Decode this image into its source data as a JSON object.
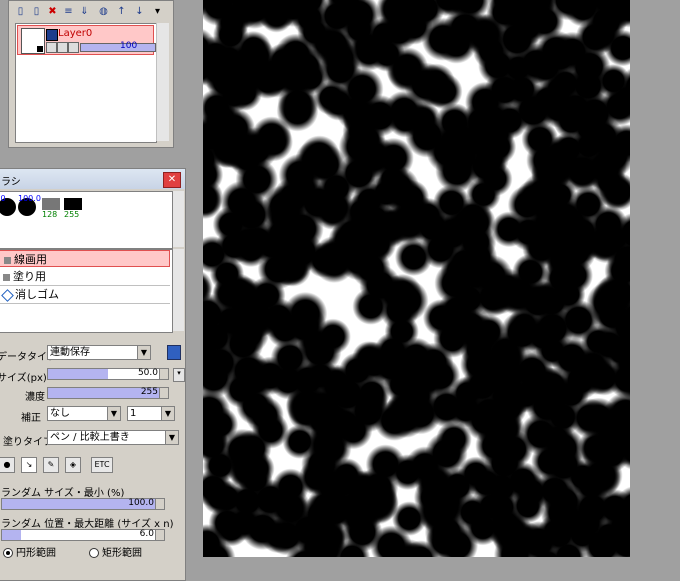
{
  "layer_panel": {
    "toolbar_icons": [
      "new-layer-icon",
      "new-layer-copy-icon",
      "delete-layer-icon",
      "merge-icon",
      "transfer-icon",
      "mask-icon",
      "move-up-icon",
      "move-down-icon",
      "menu-icon"
    ],
    "layer": {
      "name": "Layer0",
      "opacity": "100"
    }
  },
  "brush_panel": {
    "title": "ラシ",
    "presets": [
      {
        "value": ".0"
      },
      {
        "value": "100.0"
      },
      {
        "value": "128"
      },
      {
        "value": "255"
      }
    ],
    "tools": [
      {
        "label": "線画用",
        "selected": true
      },
      {
        "label": "塗り用",
        "selected": false
      },
      {
        "label": "消しゴム",
        "selected": false
      }
    ],
    "data_type_label": "データタイプ",
    "data_type_value": "連動保存",
    "size_label": "サイズ(px)",
    "size_value": "50.0",
    "density_label": "濃度",
    "density_value": "255",
    "correction_label": "補正",
    "correction_value": "なし",
    "correction_level": "1",
    "paint_type_label": "塗りタイプ",
    "paint_type_value": "ペン / 比較上書き",
    "random_size_label": "ランダム サイズ・最小 (%)",
    "random_size_value": "100.0",
    "random_pos_label": "ランダム 位置・最大距離 (サイズ x n)",
    "random_pos_value": "6.0",
    "range_circle": "円形範囲",
    "range_rect": "矩形範囲"
  },
  "colors": {
    "selected_row": "#ffc8c8",
    "slider_fill": "#b4b4f0",
    "canvas_bg": "#ffffff",
    "workspace": "#a0a0a0"
  }
}
